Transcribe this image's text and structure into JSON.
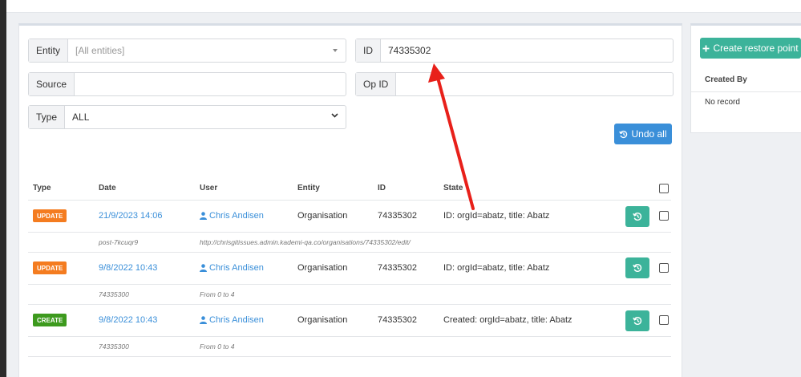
{
  "filters": {
    "entity": {
      "label": "Entity",
      "placeholder": "[All entities]"
    },
    "id": {
      "label": "ID",
      "value": "74335302"
    },
    "source": {
      "label": "Source",
      "value": ""
    },
    "op_id": {
      "label": "Op ID",
      "value": ""
    },
    "type": {
      "label": "Type",
      "value": "ALL"
    }
  },
  "undo_all_label": "Undo all",
  "create_restore_label": "Create restore point",
  "table": {
    "headers": {
      "type": "Type",
      "date": "Date",
      "user": "User",
      "entity": "Entity",
      "id": "ID",
      "state": "State"
    },
    "rows": [
      {
        "badge": "UPDATE",
        "badge_color": "#f47c20",
        "date": "21/9/2023 14:06",
        "user": "Chris Andisen",
        "entity": "Organisation",
        "id": "74335302",
        "state": "ID: orgId=abatz, title: Abatz",
        "sub_left": "post-7kcuqr9",
        "sub_right": "http://chrisgitissues.admin.kademi-qa.co/organisations/74335302/edit/"
      },
      {
        "badge": "UPDATE",
        "badge_color": "#f47c20",
        "date": "9/8/2022 10:43",
        "user": "Chris Andisen",
        "entity": "Organisation",
        "id": "74335302",
        "state": "ID: orgId=abatz, title: Abatz",
        "sub_left": "74335300",
        "sub_right": "From 0 to 4"
      },
      {
        "badge": "CREATE",
        "badge_color": "#3d9a1e",
        "date": "9/8/2022 10:43",
        "user": "Chris Andisen",
        "entity": "Organisation",
        "id": "74335302",
        "state": "Created: orgId=abatz, title: Abatz",
        "sub_left": "74335300",
        "sub_right": "From 0 to 4"
      }
    ]
  },
  "restore_panel": {
    "header": "Created By",
    "empty": "No record"
  },
  "colors": {
    "accent_blue": "#3a8fd9",
    "accent_green": "#3cb39a",
    "update": "#f47c20",
    "create": "#3d9a1e",
    "annotation_arrow": "#e8201a"
  }
}
